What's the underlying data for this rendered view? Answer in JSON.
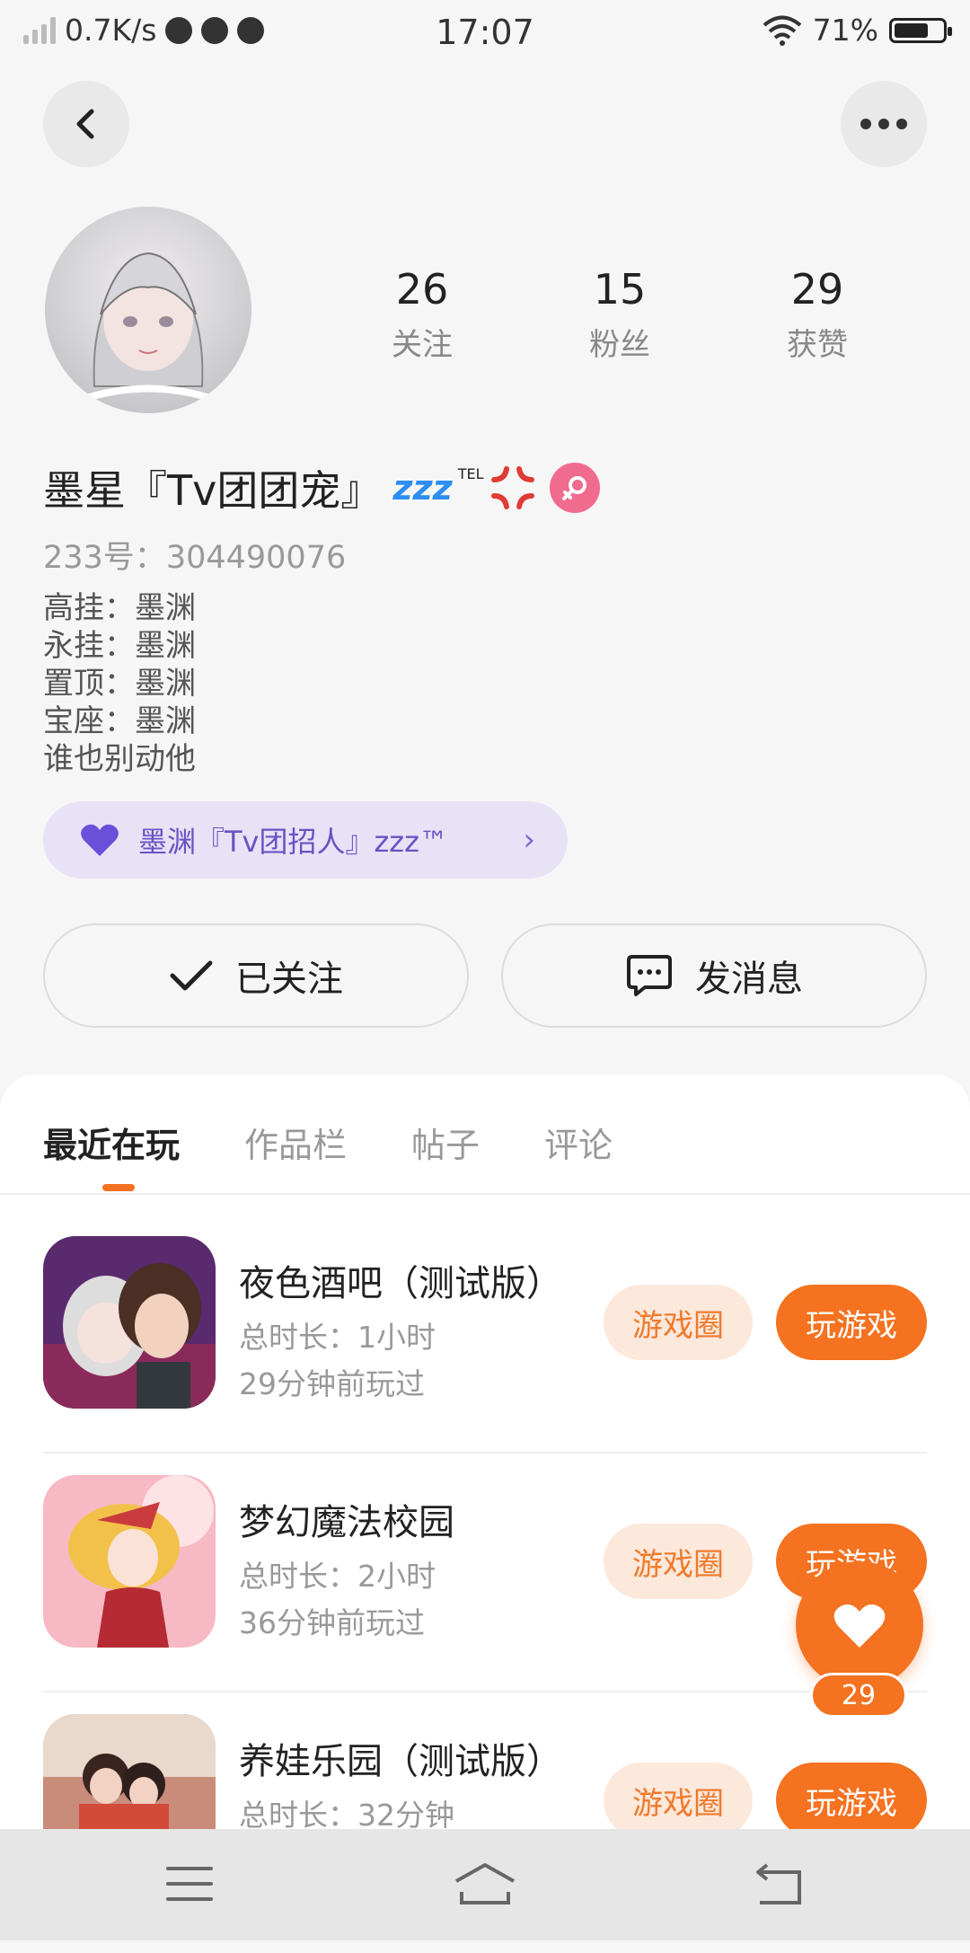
{
  "status_bar": {
    "network_speed": "0.7K/s",
    "time": "17:07",
    "battery_percent": "71%",
    "battery_level": 0.71
  },
  "header": {
    "back_icon": "chevron-left-icon",
    "more_icon": "more-horizontal-icon"
  },
  "profile": {
    "stats": [
      {
        "value": "26",
        "label": "关注"
      },
      {
        "value": "15",
        "label": "粉丝"
      },
      {
        "value": "29",
        "label": "获赞"
      }
    ],
    "nickname": "墨星『Tv团团宠』",
    "nickname_badges": {
      "zzz": "zzz",
      "tel": "TEL"
    },
    "uid_label": "233号：",
    "uid": "304490076",
    "bio": [
      "高挂：墨渊",
      "永挂：墨渊",
      "置顶：墨渊",
      "宝座：墨渊",
      "谁也别动他"
    ],
    "club": {
      "name": "墨渊『Tv团招人』zzz™",
      "icon": "heart-icon",
      "accent": "#6a52c4"
    },
    "follow_button": "已关注",
    "message_button": "发消息"
  },
  "tabs": [
    "最近在玩",
    "作品栏",
    "帖子",
    "评论"
  ],
  "active_tab": 0,
  "games": [
    {
      "title": "夜色酒吧（测试版）",
      "duration": "总时长：1小时",
      "last_played": "29分钟前玩过",
      "circle_label": "游戏圈",
      "play_label": "玩游戏"
    },
    {
      "title": "梦幻魔法校园",
      "duration": "总时长：2小时",
      "last_played": "36分钟前玩过",
      "circle_label": "游戏圈",
      "play_label": "玩游戏"
    },
    {
      "title": "养娃乐园（测试版）",
      "duration": "总时长：32分钟",
      "last_played": "",
      "circle_label": "游戏圈",
      "play_label": "玩游戏"
    }
  ],
  "like_fab": {
    "count": "29",
    "icon": "heart-icon"
  },
  "colors": {
    "accent": "#f47220",
    "accent_light": "#fde8dc",
    "club_bg": "#e8e2f6"
  },
  "nav_bar": {
    "icons": [
      "menu-icon",
      "home-icon",
      "back-icon"
    ]
  }
}
